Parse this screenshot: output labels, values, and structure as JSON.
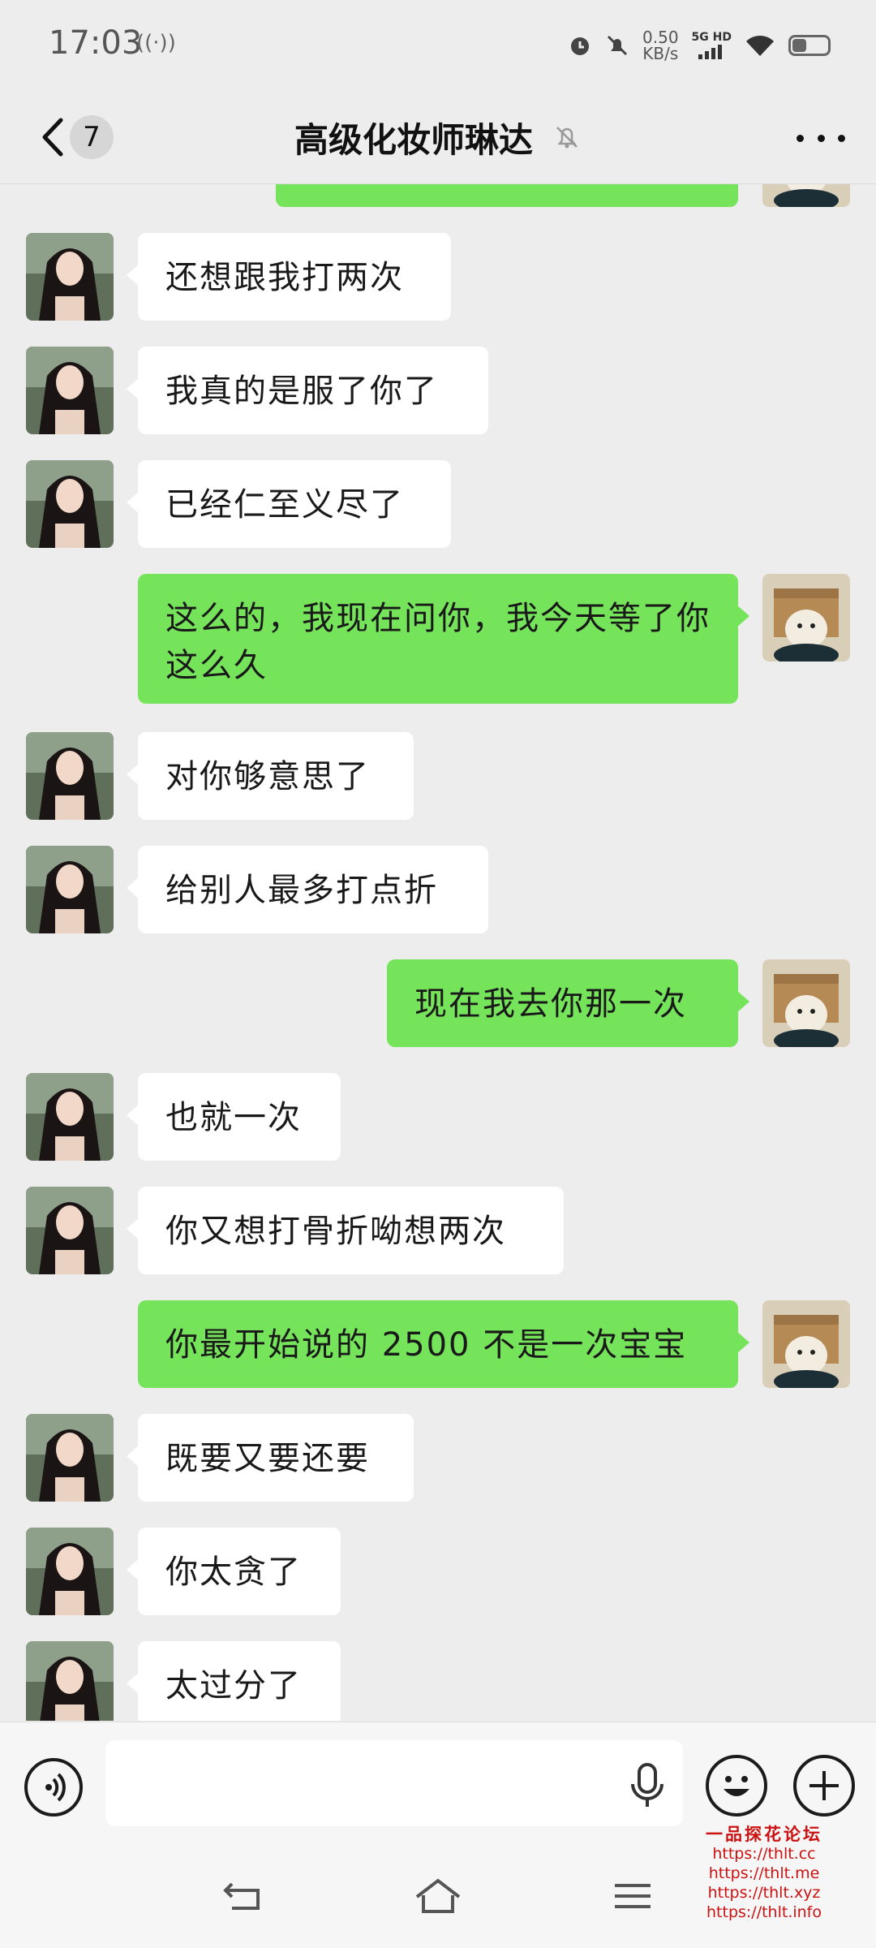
{
  "status_bar": {
    "time": "17:03",
    "net_speed": "0.50",
    "net_unit": "KB/s",
    "network_label": "5G HD",
    "battery_level": 0.45
  },
  "header": {
    "unread_count": "7",
    "title": "高级化妆师琳达"
  },
  "messages": [
    {
      "side": "in",
      "text": "还想跟我打两次"
    },
    {
      "side": "in",
      "text": "我真的是服了你了"
    },
    {
      "side": "in",
      "text": "已经仁至义尽了"
    },
    {
      "side": "out",
      "text": "这么的，我现在问你，我今天等了你这么久"
    },
    {
      "side": "in",
      "text": "对你够意思了"
    },
    {
      "side": "in",
      "text": "给别人最多打点折"
    },
    {
      "side": "out",
      "text": "现在我去你那一次"
    },
    {
      "side": "in",
      "text": "也就一次"
    },
    {
      "side": "in",
      "text": "你又想打骨折呦想两次"
    },
    {
      "side": "out",
      "text": "你最开始说的 2500 不是一次宝宝"
    },
    {
      "side": "in",
      "text": "既要又要还要"
    },
    {
      "side": "in",
      "text": "你太贪了"
    },
    {
      "side": "in",
      "text": "太过分了"
    }
  ],
  "icons": {
    "back": "chevron-left-icon",
    "mute": "bell-off-icon",
    "more": "more-dots-icon",
    "voice": "voice-icon",
    "mic": "microphone-icon",
    "emoji": "emoji-icon",
    "plus": "plus-icon"
  },
  "colors": {
    "chat_background": "#ededed",
    "outgoing_bubble": "#76e45b",
    "incoming_bubble": "#ffffff",
    "watermark": "#cc1111"
  },
  "watermark": {
    "title": "一品探花论坛",
    "links": [
      "https://thlt.cc",
      "https://thlt.me",
      "https://thlt.xyz",
      "https://thlt.info"
    ]
  }
}
